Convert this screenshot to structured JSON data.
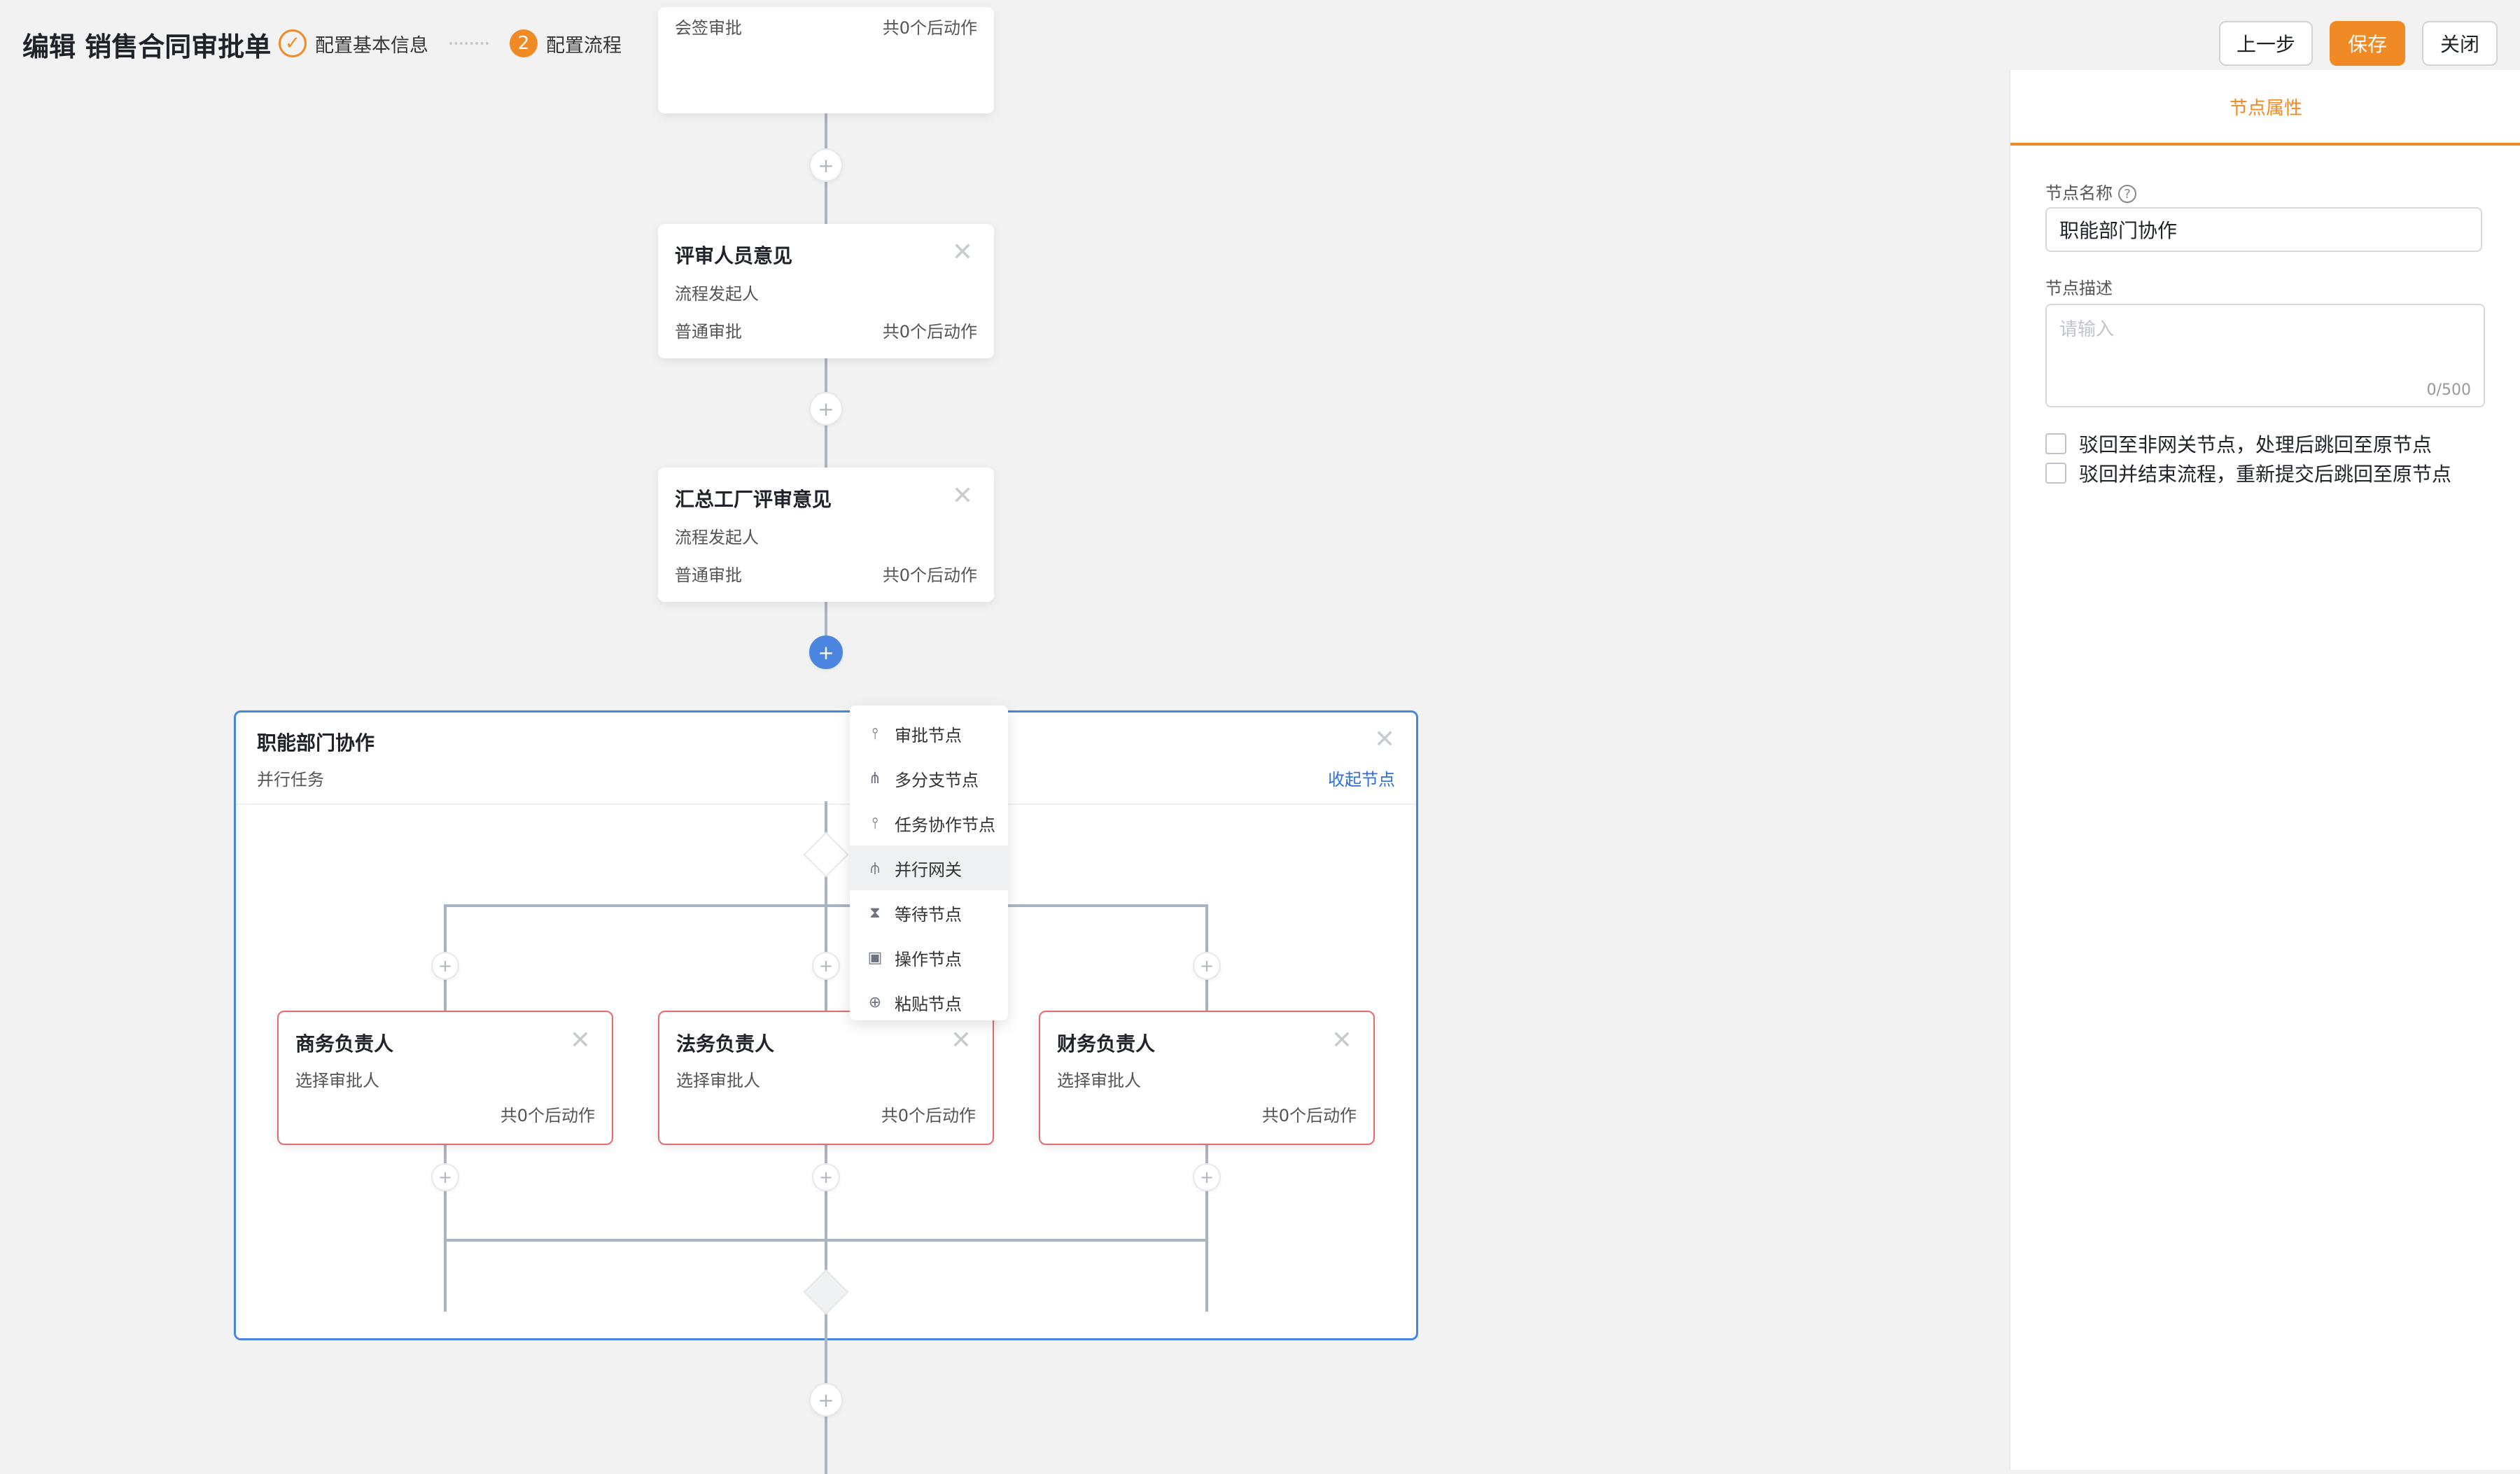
{
  "header": {
    "title": "编辑 销售合同审批单",
    "steps": [
      {
        "index": "✓",
        "label": "配置基本信息",
        "status": "done"
      },
      {
        "index": "2",
        "label": "配置流程",
        "status": "active"
      }
    ],
    "buttons": {
      "prev": "上一步",
      "save": "保存",
      "close": "关闭"
    }
  },
  "flow": {
    "top_node": {
      "type": "会签审批",
      "actions": "共0个后动作"
    },
    "nodes": [
      {
        "title": "评审人员意见",
        "assignee": "流程发起人",
        "type": "普通审批",
        "actions": "共0个后动作"
      },
      {
        "title": "汇总工厂评审意见",
        "assignee": "流程发起人",
        "type": "普通审批",
        "actions": "共0个后动作"
      }
    ],
    "group": {
      "title": "职能部门协作",
      "subtitle": "并行任务",
      "collapse_label": "收起节点",
      "branches": [
        {
          "title": "商务负责人",
          "assignee": "选择审批人",
          "actions": "共0个后动作"
        },
        {
          "title": "法务负责人",
          "assignee": "选择审批人",
          "actions": "共0个后动作"
        },
        {
          "title": "财务负责人",
          "assignee": "选择审批人",
          "actions": "共0个后动作"
        }
      ]
    },
    "add_menu": {
      "items": [
        {
          "label": "审批节点",
          "icon": "approval-node-icon"
        },
        {
          "label": "多分支节点",
          "icon": "multi-branch-icon"
        },
        {
          "label": "任务协作节点",
          "icon": "task-collab-icon"
        },
        {
          "label": "并行网关",
          "icon": "parallel-gateway-icon"
        },
        {
          "label": "等待节点",
          "icon": "hourglass-icon"
        },
        {
          "label": "操作节点",
          "icon": "operation-node-icon"
        },
        {
          "label": "粘贴节点",
          "icon": "paste-icon"
        }
      ],
      "hovered": "并行网关"
    }
  },
  "panel": {
    "tab": "节点属性",
    "name_label": "节点名称",
    "name_value": "职能部门协作",
    "desc_label": "节点描述",
    "desc_placeholder": "请输入",
    "desc_counter": "0/500",
    "options": [
      {
        "label": "驳回至非网关节点，处理后跳回至原节点",
        "checked": false
      },
      {
        "label": "驳回并结束流程，重新提交后跳回至原节点",
        "checked": false
      }
    ]
  },
  "colors": {
    "accent": "#f08a24",
    "selection": "#4a86e0",
    "branch_border": "#e46b6b"
  }
}
